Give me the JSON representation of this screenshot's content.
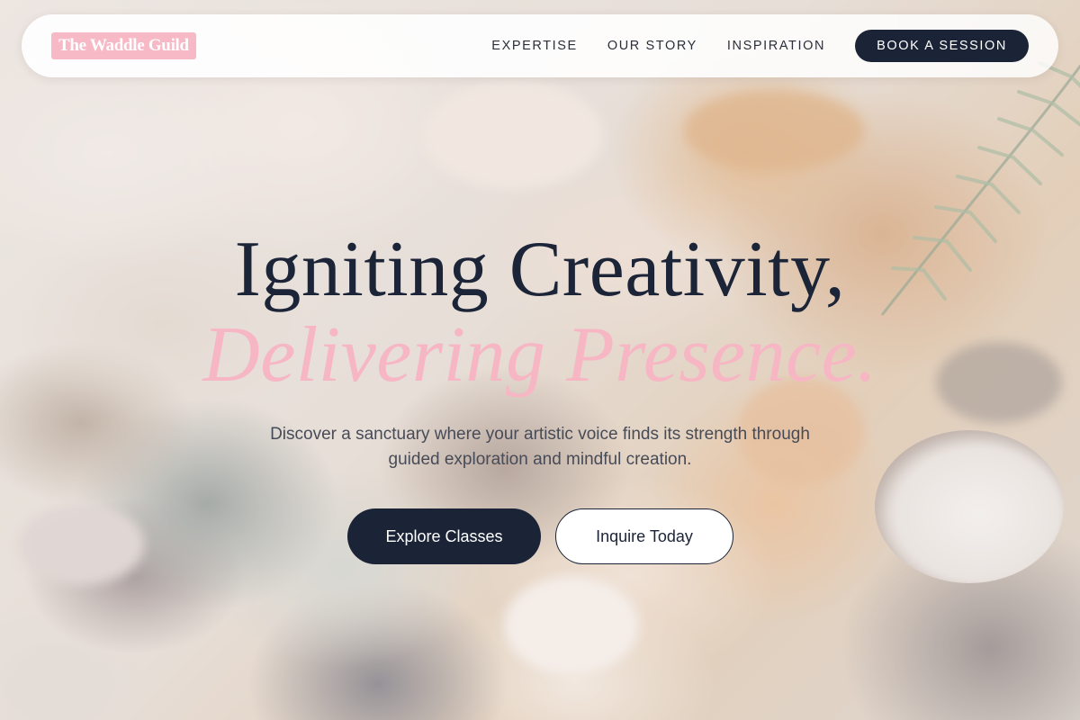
{
  "brand": {
    "name": "The Waddle Guild",
    "badge_color": "#f8b9c6"
  },
  "nav": {
    "links": [
      {
        "label": "EXPERTISE"
      },
      {
        "label": "OUR STORY"
      },
      {
        "label": "INSPIRATION"
      }
    ],
    "cta_label": "BOOK A SESSION"
  },
  "hero": {
    "headline_line1": "Igniting Creativity,",
    "headline_line2": "Delivering Presence.",
    "subtitle": "Discover a sanctuary where your artistic voice finds its strength through guided exploration and mindful creation.",
    "primary_button": "Explore Classes",
    "secondary_button": "Inquire Today"
  },
  "colors": {
    "navy": "#1b2336",
    "pink_accent": "#f7b6c4",
    "text_muted": "#474b57"
  },
  "background": {
    "description_icon": "paint-palette-image"
  }
}
